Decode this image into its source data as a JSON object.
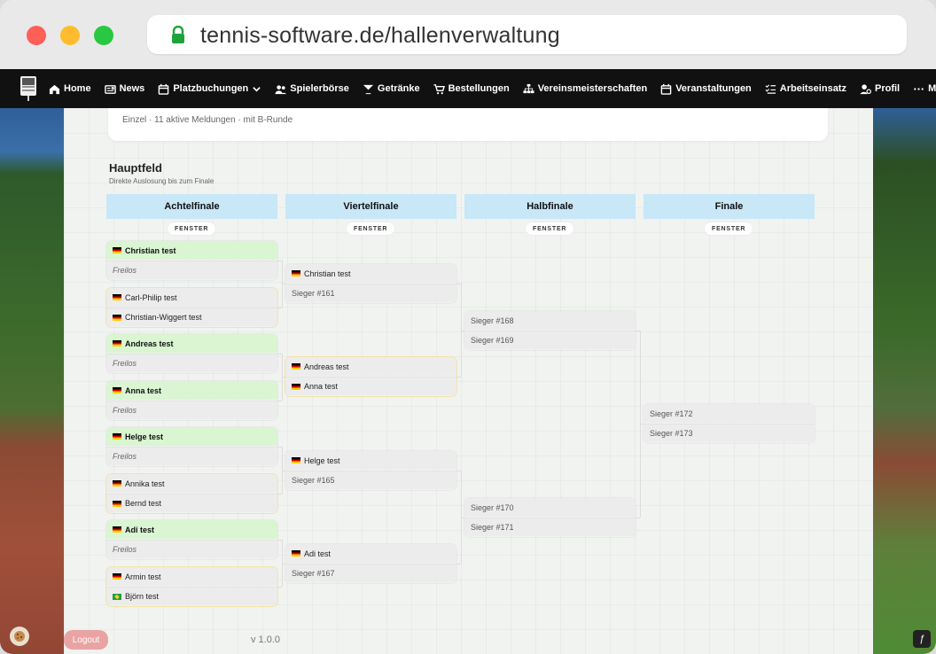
{
  "browser": {
    "url": "tennis-software.de/hallenverwaltung"
  },
  "nav": {
    "items": [
      {
        "label": "Home",
        "icon": "home-icon"
      },
      {
        "label": "News",
        "icon": "newspaper-icon"
      },
      {
        "label": "Platzbuchungen",
        "icon": "calendar-icon",
        "dropdown": true
      },
      {
        "label": "Spielerbörse",
        "icon": "users-icon"
      },
      {
        "label": "Getränke",
        "icon": "cocktail-icon"
      },
      {
        "label": "Bestellungen",
        "icon": "cart-icon"
      },
      {
        "label": "Vereinsmeisterschaften",
        "icon": "sitemap-icon"
      },
      {
        "label": "Veranstaltungen",
        "icon": "calendar-icon"
      },
      {
        "label": "Arbeitseinsatz",
        "icon": "list-check-icon"
      },
      {
        "label": "Profil",
        "icon": "user-gear-icon"
      },
      {
        "label": "Mehr",
        "icon": "ellipsis-icon",
        "dropdown": true
      }
    ]
  },
  "info": {
    "text": "Einzel · 11 aktive Meldungen · mit B-Runde"
  },
  "section": {
    "title": "Hauptfeld",
    "subtitle": "Direkte Auslosung bis zum Finale"
  },
  "rounds": [
    {
      "name": "Achtelfinale",
      "pill": "FENSTER"
    },
    {
      "name": "Viertelfinale",
      "pill": "FENSTER"
    },
    {
      "name": "Halbfinale",
      "pill": "FENSTER"
    },
    {
      "name": "Finale",
      "pill": "FENSTER"
    }
  ],
  "matches": {
    "r16": [
      {
        "top": "Christian test",
        "bottom": "Freilos",
        "top_winner": true,
        "bottom_bye": true
      },
      {
        "top": "Carl-Philip test",
        "bottom": "Christian-Wiggert test"
      },
      {
        "top": "Andreas test",
        "bottom": "Freilos",
        "top_winner": true,
        "bottom_bye": true
      },
      {
        "top": "Anna test",
        "bottom": "Freilos",
        "top_winner": true,
        "bottom_bye": true
      },
      {
        "top": "Helge test",
        "bottom": "Freilos",
        "top_winner": true,
        "bottom_bye": true
      },
      {
        "top": "Annika test",
        "bottom": "Bernd test"
      },
      {
        "top": "Adi test",
        "bottom": "Freilos",
        "top_winner": true,
        "bottom_bye": true
      },
      {
        "top": "Armin test",
        "bottom": "Björn test",
        "bottom_flag": "br"
      }
    ],
    "qf": [
      {
        "top": "Christian test",
        "bottom": "Sieger #161",
        "top_flag": true
      },
      {
        "top": "Andreas test",
        "bottom": "Anna test",
        "top_flag": true,
        "bottom_flag": true
      },
      {
        "top": "Helge test",
        "bottom": "Sieger #165",
        "top_flag": true
      },
      {
        "top": "Adi test",
        "bottom": "Sieger #167",
        "top_flag": true
      }
    ],
    "sf": [
      {
        "top": "Sieger #168",
        "bottom": "Sieger #169"
      },
      {
        "top": "Sieger #170",
        "bottom": "Sieger #171"
      }
    ],
    "final": [
      {
        "top": "Sieger #172",
        "bottom": "Sieger #173"
      }
    ]
  },
  "footer": {
    "logout": "Logout",
    "version": "v 1.0.0"
  }
}
